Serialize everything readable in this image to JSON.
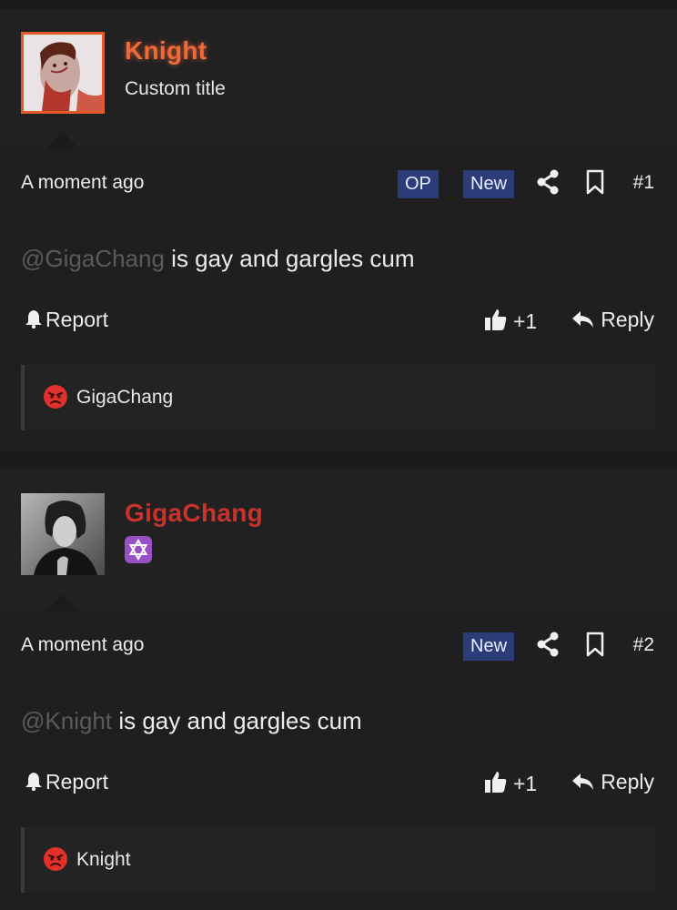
{
  "posts": [
    {
      "username": "Knight",
      "username_color": "#ef6a3a",
      "custom_title": "Custom title",
      "time": "A moment ago",
      "badges": [
        "OP",
        "New"
      ],
      "post_number": "#1",
      "mention": "@GigaChang",
      "message": " is gay and gargles cum",
      "report_label": "Report",
      "like_count": "+1",
      "reply_label": "Reply",
      "reaction_user": "GigaChang"
    },
    {
      "username": "GigaChang",
      "username_color": "#c9332b",
      "flair_icon": "star-of-david-icon",
      "time": "A moment ago",
      "badges": [
        "New"
      ],
      "post_number": "#2",
      "mention": "@Knight",
      "message": " is gay and gargles cum",
      "report_label": "Report",
      "like_count": "+1",
      "reply_label": "Reply",
      "reaction_user": "Knight"
    }
  ],
  "colors": {
    "badge_bg": "#2b3c78",
    "background": "#1b1b1c",
    "mention": "#5a5a5c",
    "angry_reaction": "#e0312a"
  }
}
